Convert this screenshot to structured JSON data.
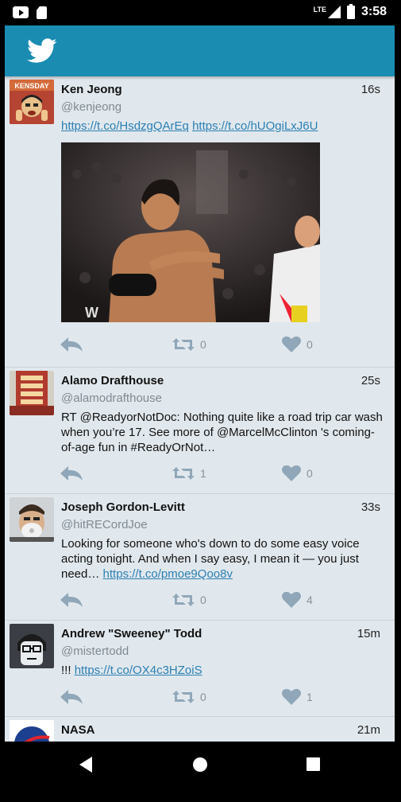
{
  "status_bar": {
    "network": "LTE",
    "time": "3:58"
  },
  "header": {
    "logo_icon": "twitter-bird-icon",
    "accent_color": "#1a8cb2"
  },
  "tweets": [
    {
      "name": "Ken Jeong",
      "handle": "@kenjeong",
      "time": "16s",
      "link1": "https://t.co/HsdzgQArEq",
      "link2": "https://t.co/hUOgiLxJ6U",
      "avatar_text": "KENSDAY",
      "retweets": "0",
      "likes": "0"
    },
    {
      "name": "Alamo Drafthouse",
      "handle": "@alamodrafthouse",
      "time": "25s",
      "text": "RT @ReadyorNotDoc: Nothing quite like a road trip car wash when you’re 17. See more of @MarcelMcClinton 's coming-of-age fun in #ReadyOrNot…",
      "retweets": "1",
      "likes": "0"
    },
    {
      "name": "Joseph Gordon-Levitt",
      "handle": "@hitRECordJoe",
      "time": "33s",
      "text": "Looking for someone who's down to do some easy voice acting tonight. And when I say easy, I mean it — you just need…",
      "link": "https://t.co/pmoe9Qoo8v",
      "retweets": "0",
      "likes": "4"
    },
    {
      "name": "Andrew \"Sweeney\" Todd",
      "handle": "@mistertodd",
      "time": "15m",
      "text": "!!!",
      "link": "https://t.co/OX4c3HZoiS",
      "retweets": "0",
      "likes": "1"
    },
    {
      "name": "NASA",
      "time": "21m"
    }
  ]
}
